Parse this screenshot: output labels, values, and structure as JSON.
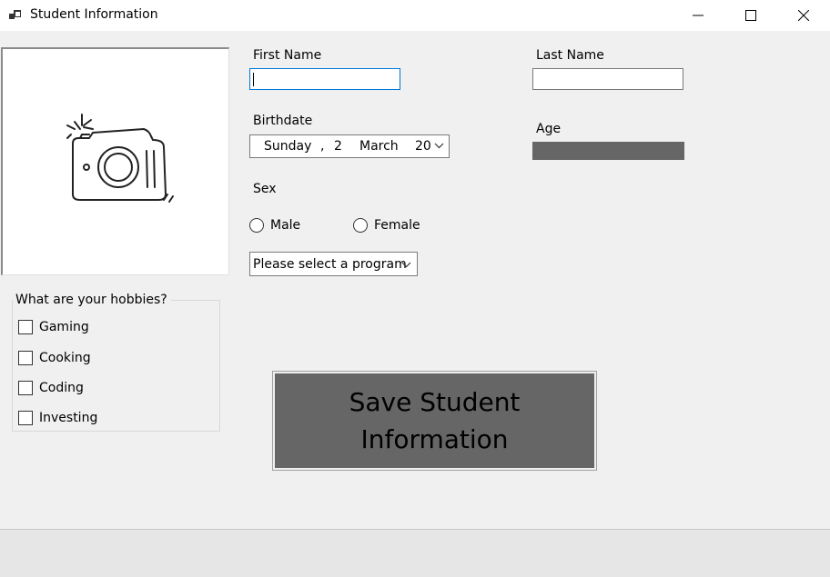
{
  "window": {
    "title": "Student Information",
    "app_icon": "app-window-icon",
    "controls": [
      "minimize-icon",
      "maximize-icon",
      "close-icon"
    ]
  },
  "form": {
    "first_name": {
      "label": "First Name",
      "value": ""
    },
    "last_name": {
      "label": "Last Name",
      "value": ""
    },
    "birthdate": {
      "label": "Birthdate",
      "weekday": "Sunday",
      "separator": ",",
      "day": "2",
      "month": "March",
      "year": "20"
    },
    "age": {
      "label": "Age"
    },
    "sex": {
      "label": "Sex",
      "options": [
        "Male",
        "Female"
      ]
    },
    "program": {
      "selected": "Please select a program"
    },
    "hobbies": {
      "legend": "What are your hobbies?",
      "items": [
        "Gaming",
        "Cooking",
        "Coding",
        "Investing"
      ]
    },
    "save_button": {
      "line1": "Save Student",
      "line2": "Information"
    }
  },
  "photo": {
    "icon": "camera-icon"
  },
  "colors": {
    "background": "#f0f0f0",
    "button_fill": "#666666",
    "focus_border": "#0078d7",
    "age_bar": "#666666"
  }
}
